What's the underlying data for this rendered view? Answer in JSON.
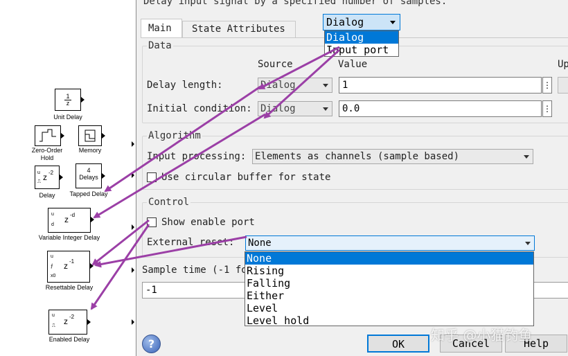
{
  "dialog": {
    "description": "Delay input signal by a specified number of samples.",
    "tabs": [
      "Main",
      "State Attributes"
    ],
    "data_group": {
      "legend": "Data",
      "col_source": "Source",
      "col_value": "Value",
      "col_up": "Up",
      "delay_length_label": "Delay length:",
      "delay_length_source": "Dialog",
      "delay_length_value": "1",
      "initial_condition_label": "Initial condition:",
      "initial_condition_source": "Dialog",
      "initial_condition_value": "0.0",
      "dots": "⋮"
    },
    "algorithm_group": {
      "legend": "Algorithm",
      "input_processing_label": "Input processing:",
      "input_processing_value": "Elements as channels (sample based)",
      "circular_buffer_label": "Use circular buffer for state"
    },
    "control_group": {
      "legend": "Control",
      "show_enable_port_label": "Show enable port",
      "external_reset_label": "External reset:",
      "external_reset_value": "None"
    },
    "sample_time_label": "Sample time (-1 fo",
    "sample_time_value": "-1",
    "source_dropdown": {
      "value": "Dialog",
      "options": [
        "Dialog",
        "Input port"
      ]
    },
    "reset_dropdown": {
      "options": [
        "None",
        "Rising",
        "Falling",
        "Either",
        "Level",
        "Level hold"
      ]
    },
    "buttons": {
      "ok": "OK",
      "cancel": "Cancel",
      "help": "Help"
    },
    "help_icon_glyph": "?"
  },
  "watermark": "知乎 @小猫钓鱼",
  "library": {
    "unit_delay": {
      "num": "1",
      "den": "z",
      "label": "Unit Delay"
    },
    "zoh": {
      "label_line1": "Zero-Order",
      "label_line2": "Hold"
    },
    "memory": {
      "label": "Memory"
    },
    "delay": {
      "text": "z",
      "exp": "-2",
      "label": "Delay",
      "port_u": "u",
      "port_reset": "⎍"
    },
    "tapped_delay": {
      "line1": "4",
      "line2": "Delays",
      "label": "Tapped Delay"
    },
    "variable_integer_delay": {
      "text": "z",
      "exp": "-d",
      "label": "Variable Integer Delay",
      "port_u": "u",
      "port_d": "d"
    },
    "resettable_delay": {
      "text": "z",
      "exp": "-1",
      "label": "Resettable Delay",
      "port_u": "u",
      "port_reset": "⨍",
      "port_x0": "x0"
    },
    "enabled_delay": {
      "text": "z",
      "exp": "-2",
      "label": "Enabled Delay",
      "port_u": "u",
      "port_en": "⎍"
    }
  },
  "colors": {
    "arrow": "#9b3fa6",
    "selection": "#0078d7",
    "dialog_bg": "#f0f0f0"
  }
}
